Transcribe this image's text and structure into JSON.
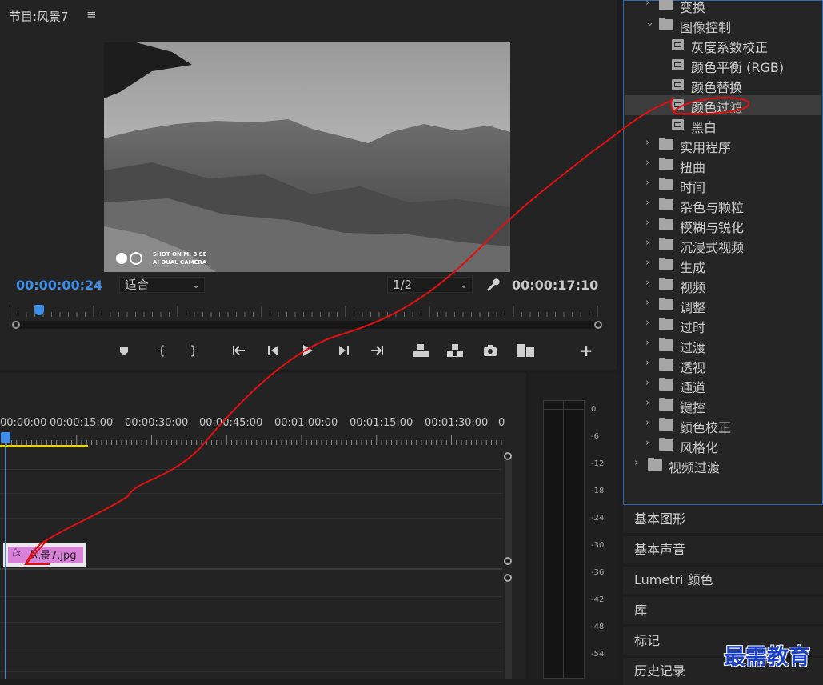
{
  "monitor": {
    "title": "节目:风景7",
    "menu_icon": "hamburger-icon",
    "watermark_line1": "SHOT ON MI 8 SE",
    "watermark_line2": "AI DUAL CAMERA",
    "current_timecode": "00:00:00:24",
    "fit_label": "适合",
    "resolution_label": "1/2",
    "duration_timecode": "00:00:17:10",
    "playhead_progress": 0.05,
    "transport_icons": [
      "add-marker-icon",
      "mark-in-icon",
      "mark-out-icon",
      "go-to-in-icon",
      "step-back-icon",
      "play-icon",
      "step-forward-icon",
      "go-to-out-icon",
      "lift-icon",
      "extract-icon",
      "export-frame-icon",
      "comparison-view-icon",
      "add-button-icon"
    ]
  },
  "timeline": {
    "ruler_labels": [
      "00:00:00",
      "00:00:15:00",
      "00:00:30:00",
      "00:00:45:00",
      "00:01:00:00",
      "00:01:15:00",
      "00:01:30:00",
      "0"
    ],
    "clip": {
      "fx": "fx",
      "name": "风景7.jpg"
    }
  },
  "audio_meter": {
    "scale": [
      "0",
      "-6",
      "-12",
      "-18",
      "-24",
      "-30",
      "-36",
      "-42",
      "-48",
      "-54"
    ]
  },
  "effects_tree": [
    {
      "label": "变换",
      "type": "folder",
      "level": 1,
      "expanded": false
    },
    {
      "label": "图像控制",
      "type": "folder",
      "level": 1,
      "expanded": true
    },
    {
      "label": "灰度系数校正",
      "type": "effect",
      "level": 2
    },
    {
      "label": "颜色平衡 (RGB)",
      "type": "effect",
      "level": 2
    },
    {
      "label": "颜色替换",
      "type": "effect",
      "level": 2
    },
    {
      "label": "颜色过滤",
      "type": "effect",
      "level": 2,
      "selected": true
    },
    {
      "label": "黑白",
      "type": "effect",
      "level": 2
    },
    {
      "label": "实用程序",
      "type": "folder",
      "level": 1,
      "expanded": false
    },
    {
      "label": "扭曲",
      "type": "folder",
      "level": 1,
      "expanded": false
    },
    {
      "label": "时间",
      "type": "folder",
      "level": 1,
      "expanded": false
    },
    {
      "label": "杂色与颗粒",
      "type": "folder",
      "level": 1,
      "expanded": false
    },
    {
      "label": "模糊与锐化",
      "type": "folder",
      "level": 1,
      "expanded": false
    },
    {
      "label": "沉浸式视频",
      "type": "folder",
      "level": 1,
      "expanded": false
    },
    {
      "label": "生成",
      "type": "folder",
      "level": 1,
      "expanded": false
    },
    {
      "label": "视频",
      "type": "folder",
      "level": 1,
      "expanded": false
    },
    {
      "label": "调整",
      "type": "folder",
      "level": 1,
      "expanded": false
    },
    {
      "label": "过时",
      "type": "folder",
      "level": 1,
      "expanded": false
    },
    {
      "label": "过渡",
      "type": "folder",
      "level": 1,
      "expanded": false
    },
    {
      "label": "透视",
      "type": "folder",
      "level": 1,
      "expanded": false
    },
    {
      "label": "通道",
      "type": "folder",
      "level": 1,
      "expanded": false
    },
    {
      "label": "键控",
      "type": "folder",
      "level": 1,
      "expanded": false
    },
    {
      "label": "颜色校正",
      "type": "folder",
      "level": 1,
      "expanded": false
    },
    {
      "label": "风格化",
      "type": "folder",
      "level": 1,
      "expanded": false
    },
    {
      "label": "视频过渡",
      "type": "folder",
      "level": 0,
      "expanded": false
    }
  ],
  "panels": [
    "基本图形",
    "基本声音",
    "Lumetri 颜色",
    "库",
    "标记",
    "历史记录"
  ],
  "watermark": "最需教育",
  "colors": {
    "accent": "#3d8ee8",
    "annotation": "#e01010",
    "clip": "#d981d9",
    "watermark": "#1a3fc2"
  }
}
